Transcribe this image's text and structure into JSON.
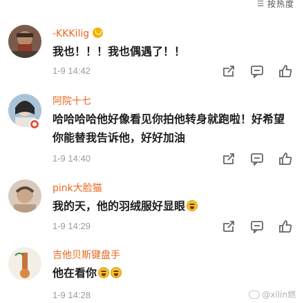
{
  "sort": {
    "icon": "sort-icon",
    "label": "按热度"
  },
  "comments": [
    {
      "username": "-KKKilig",
      "has_badge": true,
      "text": "我也！！！我也偶遇了！！",
      "time": "1-9 14:42",
      "avatar_icon": "avatar-1"
    },
    {
      "username": "阿院十七",
      "has_badge": false,
      "text": "哈哈哈哈他好像看见你拍他转身就跑啦！好希望你能替我告诉他，好好加油",
      "time": "1-9 14:40",
      "avatar_icon": "avatar-2"
    },
    {
      "username": "pink大脸猫",
      "has_badge": false,
      "text": "我的天，他的羽绒服好显眼",
      "time": "1-9 14:29",
      "avatar_icon": "avatar-3"
    },
    {
      "username": "吉他贝斯键盘手",
      "has_badge": false,
      "text": "他在看你",
      "time": "1-9 14:28",
      "avatar_icon": "avatar-4"
    }
  ],
  "action_icons": [
    "share-icon",
    "comment-icon",
    "like-icon"
  ],
  "watermark": "@xilin燃"
}
